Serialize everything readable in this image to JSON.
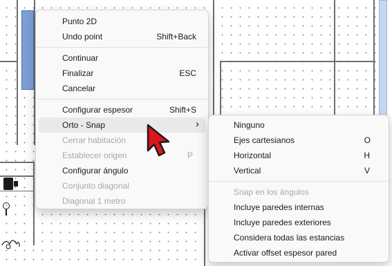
{
  "context_menu": {
    "items": [
      {
        "label": "Punto 2D",
        "shortcut": "",
        "enabled": true
      },
      {
        "label": "Undo point",
        "shortcut": "Shift+Back",
        "enabled": true
      },
      {
        "label": "Continuar",
        "shortcut": "",
        "enabled": true
      },
      {
        "label": "Finalizar",
        "shortcut": "ESC",
        "enabled": true
      },
      {
        "label": "Cancelar",
        "shortcut": "",
        "enabled": true
      },
      {
        "label": "Configurar espesor",
        "shortcut": "Shift+S",
        "enabled": true
      },
      {
        "label": "Orto - Snap",
        "shortcut": "",
        "enabled": true,
        "has_submenu": true,
        "arrow": "›"
      },
      {
        "label": "Cerrar habitación",
        "shortcut": "",
        "enabled": false
      },
      {
        "label": "Establecer origen",
        "shortcut": "P",
        "enabled": false
      },
      {
        "label": "Configurar ángulo",
        "shortcut": "",
        "enabled": true
      },
      {
        "label": "Conjunto diagonal",
        "shortcut": "",
        "enabled": false
      },
      {
        "label": "Diagonal 1 metro",
        "shortcut": "",
        "enabled": false
      }
    ]
  },
  "submenu": {
    "items": [
      {
        "label": "Ninguno",
        "shortcut": "",
        "enabled": true
      },
      {
        "label": "Ejes cartesianos",
        "shortcut": "O",
        "enabled": true
      },
      {
        "label": "Horizontal",
        "shortcut": "H",
        "enabled": true
      },
      {
        "label": "Vertical",
        "shortcut": "V",
        "enabled": true
      },
      {
        "label": "Snap en los ángulos",
        "shortcut": "",
        "enabled": false
      },
      {
        "label": "Incluye paredes internas",
        "shortcut": "",
        "enabled": true
      },
      {
        "label": "Incluye paredes exteriores",
        "shortcut": "",
        "enabled": true
      },
      {
        "label": "Considera todas las estancias",
        "shortcut": "",
        "enabled": true
      },
      {
        "label": "Activar offset espesor pared",
        "shortcut": "",
        "enabled": true
      }
    ]
  },
  "colors": {
    "canvas_bg": "#ffffff",
    "wall": "#6e6e6e",
    "selected_wall": "#7c9fd6",
    "cursor": "#e0141c",
    "menu_bg": "#f9f9f9",
    "disabled_text": "#a8a8a8"
  },
  "icons": {
    "cursor": "arrow-cursor-icon",
    "submenu_arrow": "chevron-right-icon"
  }
}
